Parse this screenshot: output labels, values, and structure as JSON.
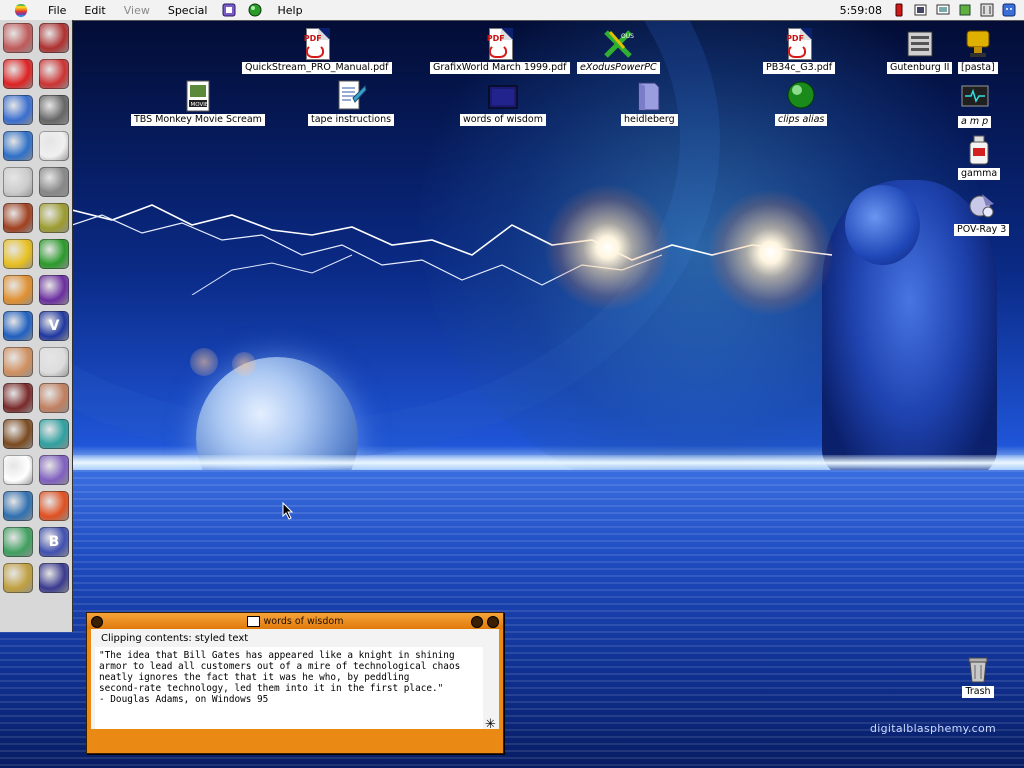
{
  "menubar": {
    "items": [
      "File",
      "Edit",
      "View",
      "Special",
      "Help"
    ],
    "disabled_items": [
      "View"
    ],
    "clock": "5:59:08"
  },
  "launcher": {
    "icons": [
      "stack-icon",
      "book-icon",
      "acrobat-icon",
      "devil-icon",
      "document-tool-icon",
      "skull-icon",
      "document-pencil-icon",
      "page-icon",
      "keyboard-icon",
      "speaker-icon",
      "monkey-icon",
      "monster-icon",
      "duck-icon",
      "green-sphere-icon",
      "burger-icon",
      "wizard-icon",
      "disk-utility-icon",
      "v-icon",
      "face-icon",
      "spray-can-icon",
      "toast-icon",
      "eye-face-icon",
      "coffee-pot-icon",
      "color-tool-icon",
      "undo-icon",
      "swirl-icon",
      "microscope-icon",
      "color-picker-icon",
      "globe-icon",
      "b-icon",
      "palette-icon",
      "spiral-icon"
    ],
    "colors": [
      "#c05a5a",
      "#b03030",
      "#dd2222",
      "#cc3333",
      "#3a6ed0",
      "#666666",
      "#2f70c8",
      "#f0f0f0",
      "#cccccc",
      "#888888",
      "#a04020",
      "#9c9c30",
      "#e8c020",
      "#2a9a2a",
      "#e09030",
      "#6a2ea0",
      "#2060c0",
      "#2038a0",
      "#d09060",
      "#dddddd",
      "#7a2a2a",
      "#c08060",
      "#7a4a20",
      "#30a0a0",
      "#ffffff",
      "#8060c0",
      "#3070b0",
      "#e05020",
      "#40a060",
      "#4050b0",
      "#c0a040",
      "#3a3a90"
    ],
    "letters": [
      "",
      "",
      "",
      "",
      "",
      "",
      "",
      "",
      "",
      "",
      "",
      "",
      "",
      "",
      "",
      "",
      "",
      "V",
      "",
      "",
      "",
      "",
      "",
      "",
      "",
      "",
      "",
      "",
      "",
      "B",
      "",
      ""
    ]
  },
  "desktop_icons": [
    {
      "label": "QuickStream_PRO_Manual.pdf",
      "type": "pdf",
      "alias": false
    },
    {
      "label": "GrafixWorld March 1999.pdf",
      "type": "pdf",
      "alias": false
    },
    {
      "label": "eXodusPowerPC",
      "type": "app",
      "alias": true
    },
    {
      "label": "PB34c_G3.pdf",
      "type": "pdf",
      "alias": false
    },
    {
      "label": "Gutenburg II",
      "type": "app",
      "alias": false
    },
    {
      "label": "[pasta]",
      "type": "app",
      "alias": false
    },
    {
      "label": "TBS Monkey Movie Scream",
      "type": "movie",
      "alias": false
    },
    {
      "label": "tape instructions",
      "type": "doc",
      "alias": false
    },
    {
      "label": "words of wisdom",
      "type": "clipping",
      "alias": false
    },
    {
      "label": "heidleberg",
      "type": "folder",
      "alias": false
    },
    {
      "label": "clips alias",
      "type": "app",
      "alias": true
    },
    {
      "label": "a m p",
      "type": "app",
      "alias": true
    },
    {
      "label": "gamma",
      "type": "app",
      "alias": false
    },
    {
      "label": "POV-Ray 3",
      "type": "app",
      "alias": false
    },
    {
      "label": "Trash",
      "type": "trash",
      "alias": false
    }
  ],
  "clipping_window": {
    "title": "words of wisdom",
    "info": "Clipping contents: styled text",
    "text": "\"The idea that Bill Gates has appeared like a knight in shining\narmor to lead all customers out of a mire of technological chaos\nneatly ignores the fact that it was he who, by peddling\nsecond-rate technology, led them into it in the first place.\"\n- Douglas Adams, on Windows 95"
  },
  "watermark": "digitalblasphemy.com",
  "colors": {
    "window_frame": "#ea8a14",
    "menubar": "#f2f2f2",
    "launcher": "#d8d8d8"
  }
}
